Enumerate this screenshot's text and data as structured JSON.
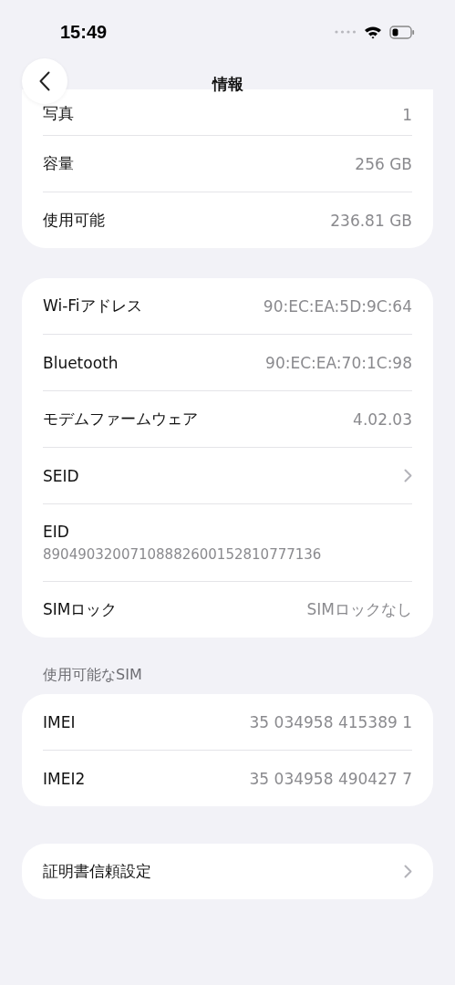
{
  "status_bar": {
    "time": "15:49"
  },
  "header": {
    "title": "情報"
  },
  "sections": [
    {
      "rows": [
        {
          "kind": "value",
          "label": "写真",
          "value": "1"
        },
        {
          "kind": "value",
          "label": "容量",
          "value": "256 GB"
        },
        {
          "kind": "value",
          "label": "使用可能",
          "value": "236.81 GB"
        }
      ]
    },
    {
      "rows": [
        {
          "kind": "value",
          "label": "Wi-Fiアドレス",
          "value": "90:EC:EA:5D:9C:64"
        },
        {
          "kind": "value",
          "label": "Bluetooth",
          "value": "90:EC:EA:70:1C:98"
        },
        {
          "kind": "value",
          "label": "モデムファームウェア",
          "value": "4.02.03"
        },
        {
          "kind": "link",
          "label": "SEID"
        },
        {
          "kind": "stacked",
          "label": "EID",
          "value": "89049032007108882600152810777136"
        },
        {
          "kind": "value",
          "label": "SIMロック",
          "value": "SIMロックなし"
        }
      ]
    },
    {
      "title": "使用可能なSIM",
      "rows": [
        {
          "kind": "value",
          "label": "IMEI",
          "value": "35 034958 415389 1"
        },
        {
          "kind": "value",
          "label": "IMEI2",
          "value": "35 034958 490427 7"
        }
      ]
    },
    {
      "rows": [
        {
          "kind": "link",
          "label": "証明書信頼設定"
        }
      ]
    }
  ]
}
